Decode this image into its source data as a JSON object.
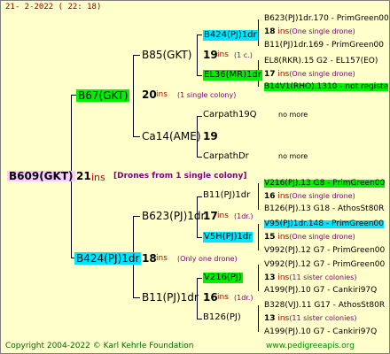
{
  "header": "21-  2-2022 (  22: 18)",
  "root": {
    "name": "B609(GKT)",
    "count": "21",
    "ins": "ins",
    "note": "[Drones from 1 single colony]"
  },
  "g1_top": {
    "name": "B67(GKT)",
    "count": "20",
    "ins": "ins",
    "note": "(1 single colony)"
  },
  "g1_bot": {
    "name": "B424(PJ)1dr",
    "count": "18",
    "ins": "ins",
    "note": "(Only one drone)"
  },
  "g2": [
    {
      "name": "B85(GKT)"
    },
    {
      "name": "Ca14(AME)",
      "count": "19"
    },
    {
      "name": "B623(PJ)1dr",
      "count": "17",
      "ins": "ins",
      "note": "(1dr.)"
    },
    {
      "name": "B11(PJ)1dr",
      "count": "16",
      "ins": "ins",
      "note": "(1dr.)"
    }
  ],
  "g3": [
    {
      "name": "B424(PJ)1dr",
      "count": "19",
      "ins": "ins",
      "note": "(1 c.)"
    },
    {
      "name": "EL36(MR)1dr",
      "count": "",
      "ins": "",
      "note": ""
    },
    {
      "name": "Carpath19Q",
      "note": "no more"
    },
    {
      "name": "CarpathDr",
      "note": "no more"
    },
    {
      "name": "B11(PJ)1dr",
      "count": "16",
      "ins": "ins",
      "note": "(One single drone)"
    },
    {
      "name": "V5H(PJ)1dr",
      "count": "15",
      "ins": "ins",
      "note": "(One single drone)"
    },
    {
      "name": "V216(PJ)",
      "count": "13",
      "ins": "ins",
      "note": "(11 sister colonies)"
    },
    {
      "name": "B126(PJ)",
      "count": "13",
      "ins": "ins",
      "note": "(11 sister colonies)"
    }
  ],
  "g4": [
    {
      "line1": "B623(PJ)1dr.170 - PrimGreen00",
      "count": "18",
      "ins": "ins",
      "note": "(One single drone)",
      "line3": "B11(PJ)1dr.169 - PrimGreen00"
    },
    {
      "line1": "EL8(RKR).15   G2 - EL157(EO)",
      "count": "17",
      "ins": "ins",
      "note": "(One single drone)",
      "line3": "B14V1(RHO).1310 - not registe"
    },
    {
      "line1": "V216(PJ).13 G8 - PrimGreen00",
      "count": "16",
      "ins": "ins",
      "note": "(One single drone)",
      "line3": "B126(PJ).13 G18 - AthosSt80R"
    },
    {
      "line1": "V95(PJ)1dr.148 - PrimGreen00",
      "count": "15",
      "ins": "ins",
      "note": "(One single drone)",
      "line3": "V992(PJ).12  G7 - PrimGreen00"
    },
    {
      "line1": "V992(PJ).12  G7 - PrimGreen00",
      "count": "13",
      "ins": "ins",
      "note": "(11 sister colonies)",
      "line3": "A199(PJ).10     G7 - Cankiri97Q"
    },
    {
      "line1": "B328(VJ).11 G17 - AthosSt80R",
      "count": "13",
      "ins": "ins",
      "note": "(11 sister colonies)",
      "line3": "A199(PJ).10     G7 - Cankiri97Q"
    }
  ],
  "footer": {
    "left": "Copyright 2004-2022 © Karl Kehrle Foundation",
    "right": "www.pedigreeapis.org"
  }
}
